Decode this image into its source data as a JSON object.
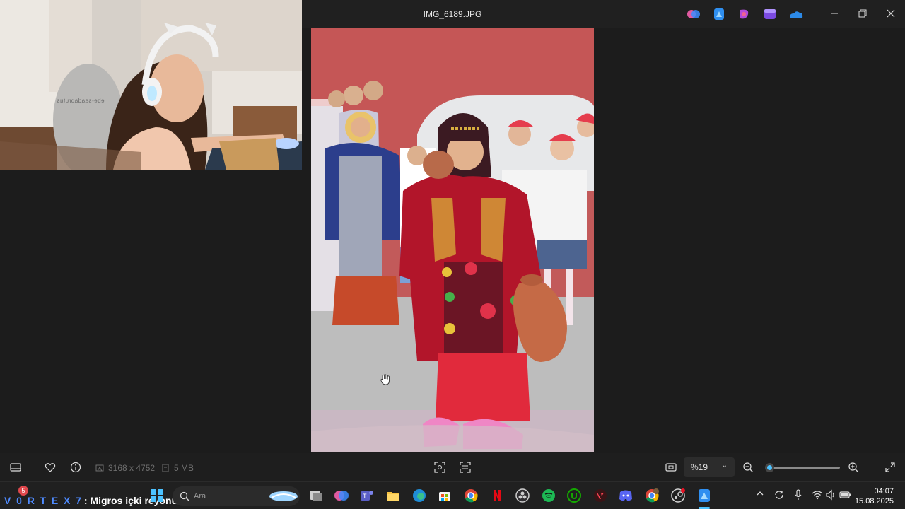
{
  "window": {
    "title": "IMG_6189.JPG",
    "controls": [
      "minimize-icon",
      "restore-icon",
      "close-icon"
    ],
    "title_app_icons": [
      "copilot-icon",
      "photos-editor-icon",
      "designer-icon",
      "clipchamp-icon",
      "onedrive-icon"
    ]
  },
  "webcam": {
    "watermark": "ebe-saadabrutus"
  },
  "image_info": {
    "dimensions": "3168 x 4752",
    "size": "5 MB"
  },
  "zoom": {
    "label": "%19",
    "level": 0.06
  },
  "toolbar_icons": [
    "filmstrip-icon",
    "favorite-heart-icon",
    "info-icon",
    "visual-search-icon",
    "ocr-scan-icon",
    "fit-screen-icon",
    "zoom-out-icon",
    "zoom-in-icon",
    "fullscreen-icon"
  ],
  "taskbar": {
    "chat_user": "V_0_R_T_E_X_7",
    "chat_separator": " : ",
    "chat_message": "Migros içki reyonunda degilim gibi cek beni",
    "badge_count": "5",
    "search_placeholder": "Ara",
    "app_icons": [
      "start-icon",
      "task-view-icon",
      "copilot-icon",
      "teams-icon",
      "file-explorer-icon",
      "edge-icon",
      "store-icon",
      "chrome-icon",
      "netflix-icon",
      "obs-icon",
      "spotify-icon",
      "upwork-icon",
      "valorant-icon",
      "discord-icon",
      "chrome-profile-icon",
      "steam-icon",
      "photos-icon"
    ],
    "tray_icons": [
      "chevron-up-icon",
      "sync-icon",
      "mic-icon",
      "wifi-icon",
      "volume-icon",
      "battery-icon"
    ],
    "time": "04:07",
    "date": "15.08.2025"
  },
  "colors": {
    "accent": "#4cc2ff",
    "chat_user": "#4f8bff",
    "bg": "#1c1c1c"
  }
}
